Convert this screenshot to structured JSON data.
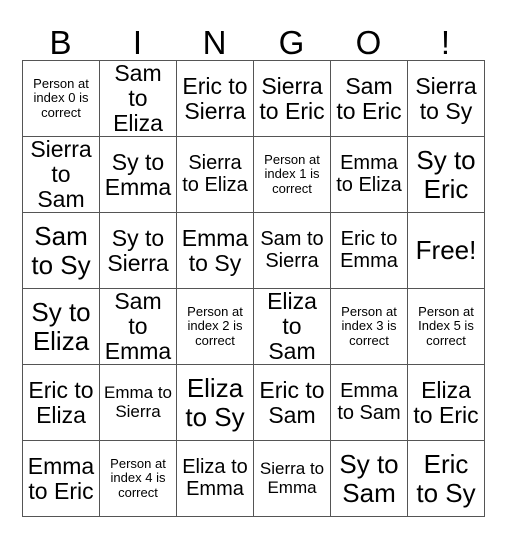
{
  "card": {
    "header_letters": [
      "B",
      "I",
      "N",
      "G",
      "O",
      "!"
    ],
    "free_space_label": "Free!",
    "colors": {
      "background": "#ffffff",
      "text": "#000000",
      "grid_line": "#555555"
    },
    "rows": [
      [
        {
          "text": "Person at index 0 is correct",
          "size": "xs"
        },
        {
          "text": "Sam to Eliza",
          "size": "lg"
        },
        {
          "text": "Eric to Sierra",
          "size": "lg"
        },
        {
          "text": "Sierra to Eric",
          "size": "lg"
        },
        {
          "text": "Sam to Eric",
          "size": "lg"
        },
        {
          "text": "Sierra to Sy",
          "size": "lg"
        }
      ],
      [
        {
          "text": "Sierra to Sam",
          "size": "lg"
        },
        {
          "text": "Sy to Emma",
          "size": "lg"
        },
        {
          "text": "Sierra to Eliza",
          "size": "md"
        },
        {
          "text": "Person at index 1 is correct",
          "size": "xs"
        },
        {
          "text": "Emma to Eliza",
          "size": "md"
        },
        {
          "text": "Sy to Eric",
          "size": "xl"
        }
      ],
      [
        {
          "text": "Sam to Sy",
          "size": "xl"
        },
        {
          "text": "Sy to Sierra",
          "size": "lg"
        },
        {
          "text": "Emma to Sy",
          "size": "lg"
        },
        {
          "text": "Sam to Sierra",
          "size": "md"
        },
        {
          "text": "Eric to Emma",
          "size": "md"
        },
        {
          "text": "Free!",
          "size": "xl"
        }
      ],
      [
        {
          "text": "Sy to Eliza",
          "size": "xl"
        },
        {
          "text": "Sam to Emma",
          "size": "lg"
        },
        {
          "text": "Person at index 2 is correct",
          "size": "xs"
        },
        {
          "text": "Eliza to Sam",
          "size": "lg"
        },
        {
          "text": "Person at index 3 is correct",
          "size": "xs"
        },
        {
          "text": "Person at Index 5 is correct",
          "size": "xs"
        }
      ],
      [
        {
          "text": "Eric to Eliza",
          "size": "lg"
        },
        {
          "text": "Emma to Sierra",
          "size": "sm"
        },
        {
          "text": "Eliza to Sy",
          "size": "xl"
        },
        {
          "text": "Eric to Sam",
          "size": "lg"
        },
        {
          "text": "Emma to Sam",
          "size": "md"
        },
        {
          "text": "Eliza to Eric",
          "size": "lg"
        }
      ],
      [
        {
          "text": "Emma to Eric",
          "size": "lg"
        },
        {
          "text": "Person at index 4 is correct",
          "size": "xs"
        },
        {
          "text": "Eliza to Emma",
          "size": "md"
        },
        {
          "text": "Sierra to Emma",
          "size": "sm"
        },
        {
          "text": "Sy to Sam",
          "size": "xl"
        },
        {
          "text": "Eric to Sy",
          "size": "xl"
        }
      ]
    ]
  }
}
